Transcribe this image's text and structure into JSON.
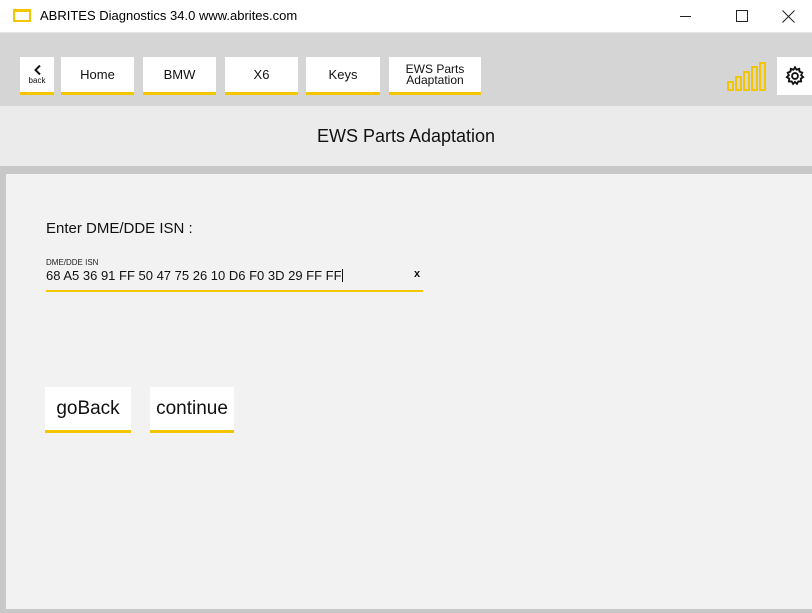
{
  "window": {
    "title": "ABRITES Diagnostics 34.0  www.abrites.com",
    "accent_color": "#f3c600"
  },
  "nav": {
    "back_label": "back",
    "items": [
      {
        "label": "Home"
      },
      {
        "label": "BMW"
      },
      {
        "label": "X6"
      },
      {
        "label": "Keys"
      },
      {
        "label": "EWS Parts Adaptation"
      }
    ],
    "signal_icon": "signal-strength-icon",
    "settings_icon": "gear-icon"
  },
  "page": {
    "title": "EWS Parts Adaptation"
  },
  "form": {
    "prompt": "Enter DME/DDE ISN :",
    "isn_label": "DME/DDE ISN",
    "isn_value": "68 A5 36 91 FF 50 47 75 26 10 D6 F0 3D 29 FF FF",
    "clear_label": "x"
  },
  "actions": {
    "go_back": "goBack",
    "continue": "continue"
  }
}
